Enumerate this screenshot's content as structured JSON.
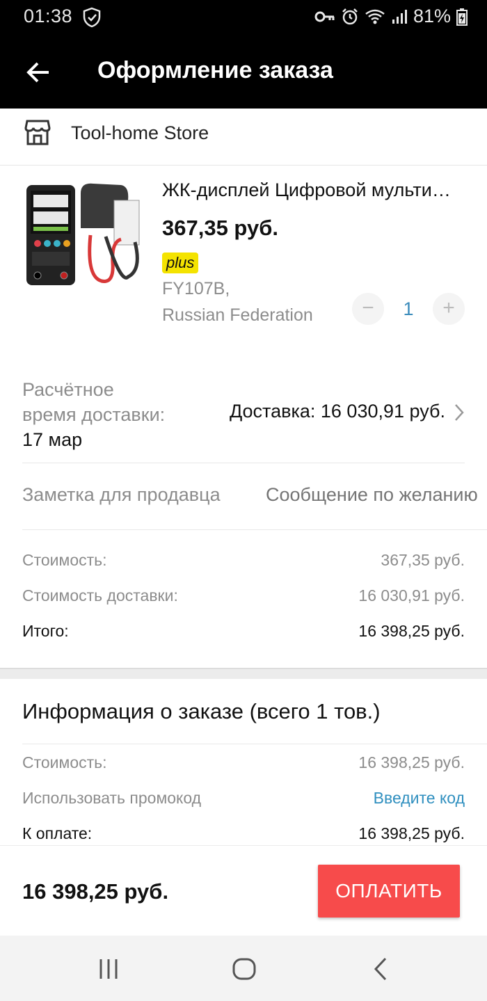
{
  "status_bar": {
    "time": "01:38",
    "battery": "81%"
  },
  "app_bar": {
    "title": "Оформление заказа"
  },
  "store": {
    "name": "Tool-home Store"
  },
  "product": {
    "name": "ЖК-дисплей Цифровой мульти…",
    "price": "367,35 руб.",
    "badge": "plus",
    "sku_line1": "FY107B,",
    "sku_line2": "Russian Federation",
    "quantity": "1",
    "minus": "−",
    "plus": "+"
  },
  "delivery": {
    "label_line1": "Расчётное",
    "label_line2": "время доставки:",
    "date": "17 мар",
    "cost": "Доставка: 16 030,91 руб."
  },
  "note": {
    "label": "Заметка для продавца",
    "placeholder": "Сообщение по желанию"
  },
  "summary": {
    "cost_label": "Стоимость:",
    "cost_value": "367,35 руб.",
    "shipping_label": "Стоимость доставки:",
    "shipping_value": "16 030,91 руб.",
    "total_label": "Итого:",
    "total_value": "16 398,25 руб."
  },
  "order_info": {
    "title": "Информация о заказе (всего 1 тов.)",
    "cost_label": "Стоимость:",
    "cost_value": "16 398,25 руб.",
    "promo_label": "Использовать промокод",
    "promo_link": "Введите код",
    "pay_label": "К оплате:",
    "pay_value": "16 398,25 руб."
  },
  "bottom_bar": {
    "total": "16 398,25 руб.",
    "pay_button": "ОПЛАТИТЬ"
  },
  "colors": {
    "accent_red": "#f74b4b",
    "link_blue": "#2f8fbf",
    "badge_yellow": "#f4e300"
  }
}
